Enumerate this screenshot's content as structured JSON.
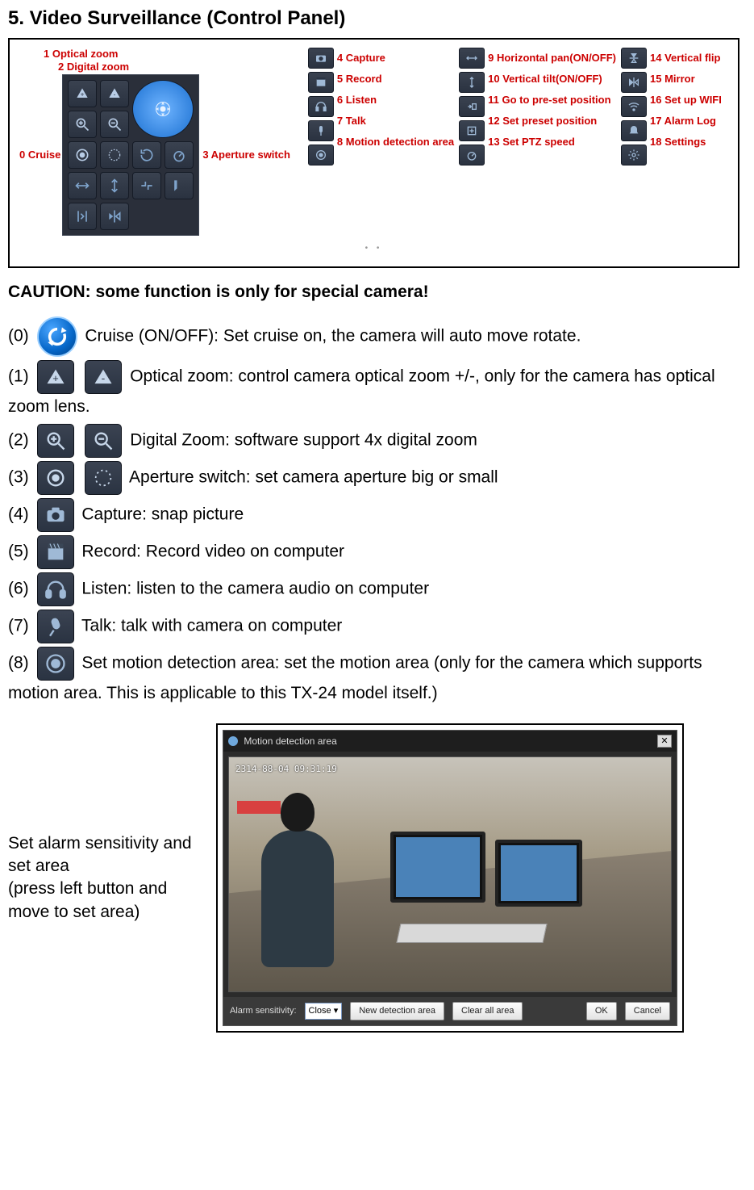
{
  "heading": "5. Video Surveillance (Control Panel)",
  "panel": {
    "left0": "0 Cruise",
    "top1": "1 Optical zoom",
    "top2": "2 Digital zoom",
    "right3": "3 Aperture switch",
    "colA": [
      "4 Capture",
      "5 Record",
      "6 Listen",
      "7 Talk",
      "8 Motion detection area"
    ],
    "colB": [
      "9 Horizontal pan(ON/OFF)",
      "10 Vertical tilt(ON/OFF)",
      "11 Go to pre-set position",
      "12 Set preset position",
      "13 Set PTZ speed"
    ],
    "colC": [
      "14 Vertical flip",
      "15 Mirror",
      "16 Set up WIFI",
      "17 Alarm Log",
      "18 Settings"
    ]
  },
  "caution": "CAUTION: some function is only for special camera!",
  "items": [
    {
      "n": "(0)",
      "text": "  Cruise (ON/OFF): Set cruise on, the camera will auto move rotate."
    },
    {
      "n": "(1)",
      "text": "   Optical zoom: control camera optical zoom +/-, only for the camera has optical zoom lens."
    },
    {
      "n": "(2)",
      "text": "   Digital Zoom: software support 4x digital zoom"
    },
    {
      "n": "(3)",
      "text": "   Aperture switch: set camera aperture big or small"
    },
    {
      "n": "(4)",
      "text": "  Capture: snap picture"
    },
    {
      "n": "(5)",
      "text": "  Record: Record video on computer"
    },
    {
      "n": "(6)",
      "text": "  Listen: listen to the camera audio on computer"
    },
    {
      "n": "(7)",
      "text": "  Talk: talk with camera on computer"
    },
    {
      "n": "(8)",
      "text": "  Set motion detection area: set the motion area (only for the camera which supports motion area. This is applicable to this TX-24 model itself.)"
    }
  ],
  "leftnote": {
    "l1": "Set alarm sensitivity and set area",
    "l2": "(press left button and move to set area)"
  },
  "md": {
    "title": "Motion detection area",
    "timestamp": "2314-88-04 09:31:19",
    "sens_label": "Alarm sensitivity:",
    "sens_value": "Close",
    "btn_new": "New detection area",
    "btn_clear": "Clear all area",
    "btn_ok": "OK",
    "btn_cancel": "Cancel"
  }
}
